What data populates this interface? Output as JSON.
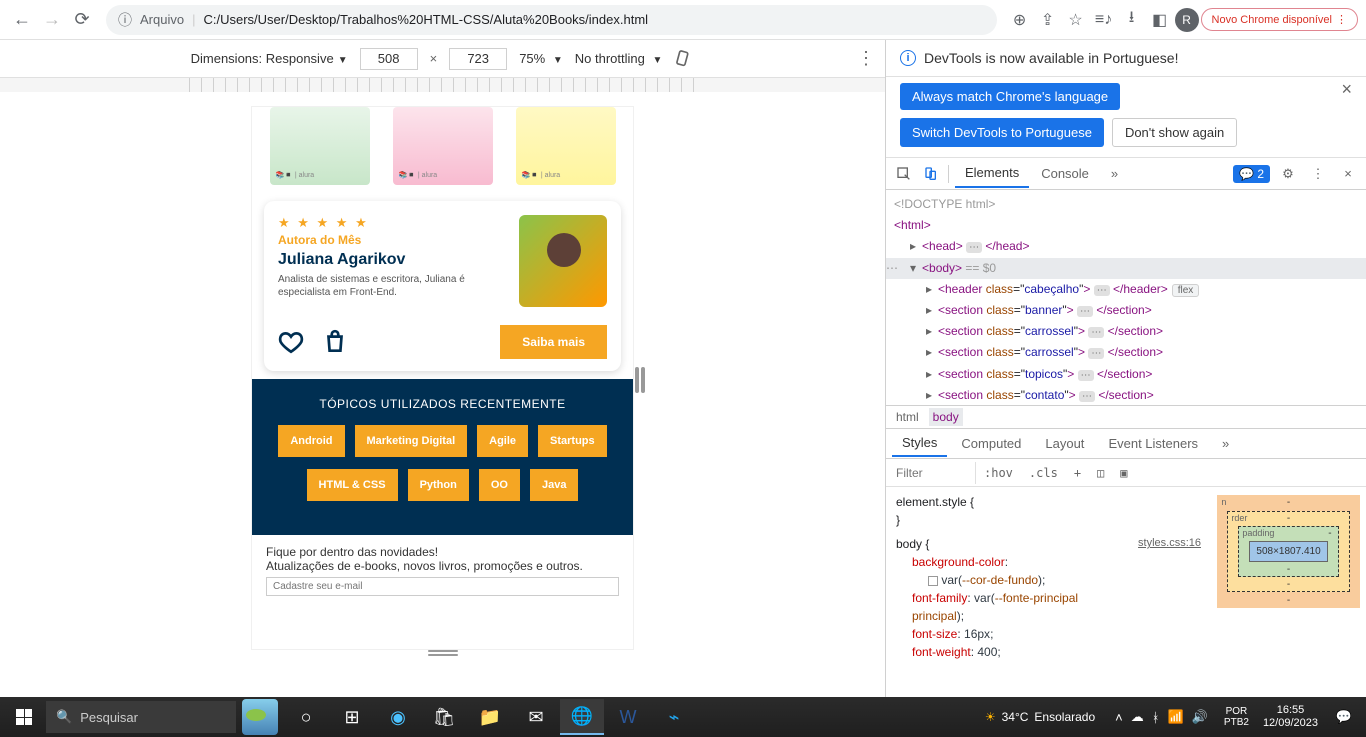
{
  "browser": {
    "address_label": "Arquivo",
    "url": "C:/Users/User/Desktop/Trabalhos%20HTML-CSS/Aluta%20Books/index.html",
    "profile_letter": "R",
    "chrome_update": "Novo Chrome disponível"
  },
  "device_toolbar": {
    "dimensions_label": "Dimensions: Responsive",
    "width": "508",
    "height": "723",
    "zoom": "75%",
    "throttling": "No throttling"
  },
  "site": {
    "book_brand": "📚◾ | alura",
    "author": {
      "stars": "★ ★ ★ ★ ★",
      "badge": "Autora do Mês",
      "name": "Juliana Agarikov",
      "description": "Analista de sistemas e escritora, Juliana é especialista em Front-End.",
      "cta": "Saiba mais"
    },
    "topics": {
      "title": "TÓPICOS UTILIZADOS RECENTEMENTE",
      "row1": [
        "Android",
        "Marketing Digital",
        "Agile",
        "Startups"
      ],
      "row2": [
        "HTML & CSS",
        "Python",
        "OO",
        "Java"
      ]
    },
    "newsletter": {
      "title": "Fique por dentro das novidades!",
      "subtitle": "Atualizações de e-books, novos livros, promoções e outros.",
      "placeholder": "Cadastre seu e-mail"
    }
  },
  "devtools": {
    "notice": "DevTools is now available in Portuguese!",
    "btn_always": "Always match Chrome's language",
    "btn_switch": "Switch DevTools to Portuguese",
    "btn_dont": "Don't show again",
    "tabs": {
      "elements": "Elements",
      "console": "Console"
    },
    "issues_count": "2",
    "elements": {
      "doctype": "<!DOCTYPE html>",
      "html_open": "html",
      "head": "head",
      "body": "body",
      "body_eq": "== $0",
      "header_class": "cabeçalho",
      "header_badge": "flex",
      "s_banner": "banner",
      "s_carrossel": "carrossel",
      "s_topicos": "topicos",
      "s_contato": "contato"
    },
    "breadcrumb": {
      "html": "html",
      "body": "body"
    },
    "styles_tabs": {
      "styles": "Styles",
      "computed": "Computed",
      "layout": "Layout",
      "events": "Event Listeners"
    },
    "filter": "Filter",
    "hov": ":hov",
    "cls": ".cls",
    "css": {
      "element_style": "element.style",
      "body_sel": "body",
      "src": "styles.css:16",
      "bg_prop": "background-color",
      "bg_var": "--cor-de-fundo",
      "ff_prop": "font-family",
      "ff_var": "--fonte-principal",
      "fs_prop": "font-size",
      "fs_val": "16px",
      "fw_prop": "font-weight",
      "fw_val": "400"
    },
    "box_model": {
      "margin_label": "n",
      "border_label": "rder",
      "padding_label": "padding",
      "content": "508×1807.410",
      "dash": "-"
    }
  },
  "taskbar": {
    "search": "Pesquisar",
    "weather_temp": "34°C",
    "weather_cond": "Ensolarado",
    "lang1": "POR",
    "lang2": "PTB2",
    "time": "16:55",
    "date": "12/09/2023"
  }
}
